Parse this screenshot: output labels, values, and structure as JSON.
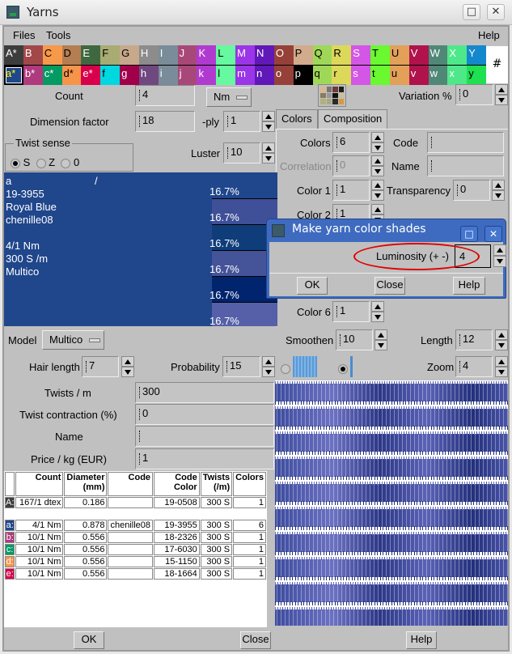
{
  "window": {
    "title": "Yarns",
    "maximize_icon": "□",
    "close_icon": "✕"
  },
  "menu": {
    "files": "Files",
    "tools": "Tools",
    "help": "Help"
  },
  "palette": {
    "upper": [
      {
        "label": "A*",
        "color": "#3d3d3d"
      },
      {
        "label": "B",
        "color": "#a24848"
      },
      {
        "label": "C",
        "color": "#f7994a"
      },
      {
        "label": "D",
        "color": "#b47d52"
      },
      {
        "label": "E",
        "color": "#406840"
      },
      {
        "label": "F",
        "color": "#a8ac72"
      },
      {
        "label": "G",
        "color": "#c6a98b"
      },
      {
        "label": "H",
        "color": "#8c8c8c"
      },
      {
        "label": "I",
        "color": "#7a8c99"
      },
      {
        "label": "J",
        "color": "#a84878"
      },
      {
        "label": "K",
        "color": "#b03ad0"
      },
      {
        "label": "L",
        "color": "#66f99f"
      },
      {
        "label": "M",
        "color": "#9a35e8"
      },
      {
        "label": "N",
        "color": "#6018b8"
      },
      {
        "label": "O",
        "color": "#96403a"
      },
      {
        "label": "P",
        "color": "#d2aa8c"
      },
      {
        "label": "Q",
        "color": "#9fd858"
      },
      {
        "label": "R",
        "color": "#dcd85a"
      },
      {
        "label": "S",
        "color": "#d456e6"
      },
      {
        "label": "T",
        "color": "#6af830"
      },
      {
        "label": "U",
        "color": "#e2a058"
      },
      {
        "label": "V",
        "color": "#b0124c"
      },
      {
        "label": "W",
        "color": "#508878"
      },
      {
        "label": "X",
        "color": "#4ee88a"
      },
      {
        "label": "Y",
        "color": "#1388cc"
      }
    ],
    "lower": [
      {
        "label": "a*",
        "color": "#20468b"
      },
      {
        "label": "b*",
        "color": "#b03a7e"
      },
      {
        "label": "c*",
        "color": "#049a64"
      },
      {
        "label": "d*",
        "color": "#f7944a"
      },
      {
        "label": "e*",
        "color": "#d8004c"
      },
      {
        "label": "f",
        "color": "#00d8e0"
      },
      {
        "label": "g",
        "color": "#a0004a"
      },
      {
        "label": "h",
        "color": "#704880"
      },
      {
        "label": "i",
        "color": "#7a8c99"
      },
      {
        "label": "j",
        "color": "#a84878"
      },
      {
        "label": "k",
        "color": "#b03ad0"
      },
      {
        "label": "l",
        "color": "#66f99f"
      },
      {
        "label": "m",
        "color": "#9a35e8"
      },
      {
        "label": "n",
        "color": "#6018b8"
      },
      {
        "label": "o",
        "color": "#96403a"
      },
      {
        "label": "p",
        "color": "#000000"
      },
      {
        "label": "q",
        "color": "#9fd858"
      },
      {
        "label": "r",
        "color": "#dcd85a"
      },
      {
        "label": "s",
        "color": "#d456e6"
      },
      {
        "label": "t",
        "color": "#6af830"
      },
      {
        "label": "u",
        "color": "#e2a058"
      },
      {
        "label": "v",
        "color": "#b0124c"
      },
      {
        "label": "w",
        "color": "#508878"
      },
      {
        "label": "x",
        "color": "#4ee88a"
      },
      {
        "label": "y",
        "color": "#1ee050"
      }
    ],
    "hash": "#"
  },
  "form": {
    "count": {
      "label": "Count",
      "value": "4"
    },
    "unit": {
      "value": "Nm"
    },
    "variation": {
      "label": "Variation %",
      "value": "0"
    },
    "dimension_factor": {
      "label": "Dimension factor",
      "value": "18"
    },
    "ply": {
      "label": "-ply",
      "value": "1"
    },
    "twist_sense": {
      "label": "Twist sense",
      "options": [
        "S",
        "Z",
        "0"
      ],
      "selected": "S"
    },
    "luster": {
      "label": "Luster",
      "value": "10"
    }
  },
  "tabs": {
    "colors": "Colors",
    "composition": "Composition",
    "active": "Colors"
  },
  "colors_tab": {
    "colors": {
      "label": "Colors",
      "value": "6"
    },
    "correlation": {
      "label": "Correlation",
      "value": "0"
    },
    "color1": {
      "label": "Color 1",
      "value": "1"
    },
    "color2": {
      "label": "Color 2",
      "value": "1"
    },
    "color6": {
      "label": "Color 6",
      "value": "1"
    },
    "code": {
      "label": "Code",
      "value": ""
    },
    "name": {
      "label": "Name",
      "value": ""
    },
    "transparency": {
      "label": "Transparency",
      "value": "0"
    }
  },
  "info_panel": {
    "lines": [
      "a",
      "19-3955",
      "Royal Blue",
      "chenille08",
      "",
      "4/1 Nm",
      "300 S /m",
      "Multico"
    ],
    "slash": "/",
    "shades": [
      {
        "percent": "16.7%",
        "color": "#20468b"
      },
      {
        "percent": "16.7%",
        "color": "#3f4f98"
      },
      {
        "percent": "16.7%",
        "color": "#0e3d7a"
      },
      {
        "percent": "16.7%",
        "color": "#455499"
      },
      {
        "percent": "16.7%",
        "color": "#00246e"
      },
      {
        "percent": "16.7%",
        "color": "#5560a8"
      }
    ]
  },
  "dialog": {
    "title": "Make yarn color shades",
    "luminosity_label": "Luminosity (+ -)",
    "luminosity_value": "4",
    "ok": "OK",
    "close": "Close",
    "help": "Help",
    "annotation_color": "#e00000"
  },
  "lower_form": {
    "model": {
      "label": "Model",
      "value": "Multico"
    },
    "smoothen": {
      "label": "Smoothen",
      "value": "10"
    },
    "length": {
      "label": "Length",
      "value": "12"
    },
    "hair_length": {
      "label": "Hair length",
      "value": "7"
    },
    "probability": {
      "label": "Probability",
      "value": "15"
    },
    "zoom": {
      "label": "Zoom",
      "value": "4"
    },
    "view_mode": {
      "options": [
        "texture",
        "line"
      ],
      "selected": "line"
    },
    "twists_m": {
      "label": "Twists / m",
      "value": "300"
    },
    "twist_contraction": {
      "label": "Twist contraction (%)",
      "value": "0"
    },
    "name": {
      "label": "Name",
      "value": ""
    },
    "price": {
      "label": "Price / kg (EUR)",
      "value": "1"
    }
  },
  "table": {
    "headers": [
      "",
      "Count",
      "Diameter (mm)",
      "Code",
      "Code Color",
      "Twists (/m)",
      "Colors"
    ],
    "rows": [
      {
        "key": "A:",
        "color": "#3d3d3d",
        "count": "167/1 dtex",
        "diameter": "0.186",
        "code": "",
        "code_color": "19-0508",
        "twists": "300 S",
        "colors": "1"
      },
      {
        "key": "a:",
        "color": "#20468b",
        "count": "4/1 Nm",
        "diameter": "0.878",
        "code": "chenille08",
        "code_color": "19-3955",
        "twists": "300 S",
        "colors": "6"
      },
      {
        "key": "b:",
        "color": "#b03a7e",
        "count": "10/1 Nm",
        "diameter": "0.556",
        "code": "",
        "code_color": "18-2326",
        "twists": "300 S",
        "colors": "1"
      },
      {
        "key": "c:",
        "color": "#049a64",
        "count": "10/1 Nm",
        "diameter": "0.556",
        "code": "",
        "code_color": "17-6030",
        "twists": "300 S",
        "colors": "1"
      },
      {
        "key": "d:",
        "color": "#f7944a",
        "count": "10/1 Nm",
        "diameter": "0.556",
        "code": "",
        "code_color": "15-1150",
        "twists": "300 S",
        "colors": "1"
      },
      {
        "key": "e:",
        "color": "#d8004c",
        "count": "10/1 Nm",
        "diameter": "0.556",
        "code": "",
        "code_color": "18-1664",
        "twists": "300 S",
        "colors": "1"
      }
    ]
  },
  "footer": {
    "ok": "OK",
    "close": "Close",
    "help": "Help"
  }
}
